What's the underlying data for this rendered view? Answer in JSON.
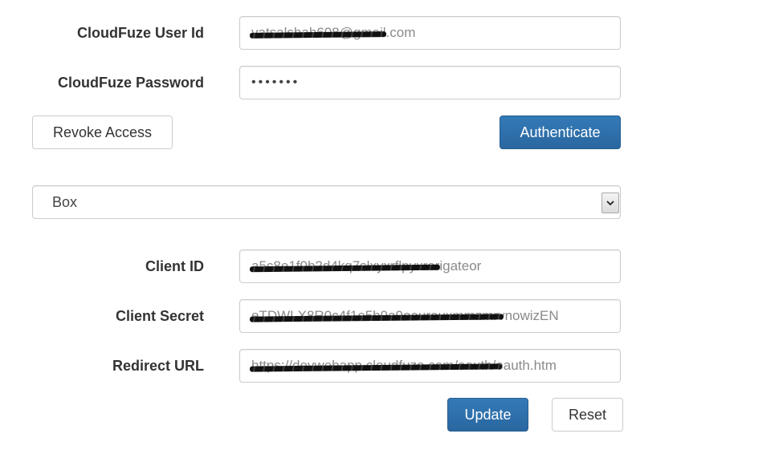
{
  "credentials": {
    "user_id_label": "CloudFuze User Id",
    "user_id_value": "vatsalshah608@gmail.com",
    "password_label": "CloudFuze Password",
    "password_value": "•••••••"
  },
  "actions": {
    "revoke_label": "Revoke Access",
    "authenticate_label": "Authenticate"
  },
  "provider": {
    "selected": "Box",
    "arrow_icon": "chevron-down-icon"
  },
  "app_config": {
    "client_id_label": "Client ID",
    "client_id_value": "a5c8e1f0b2d4kq7slxyxrflpyxrorigateor",
    "client_secret_label": "Client Secret",
    "client_secret_value": "eTDWLX8R0c4f1e5b9a9oaurouxmmzmrvnowizEN",
    "redirect_url_label": "Redirect URL",
    "redirect_url_value": "https://devwebapp.cloudfuze.com/oauth/oauth.htm"
  },
  "form_actions": {
    "update_label": "Update",
    "reset_label": "Reset"
  },
  "colors": {
    "primary": "#337ab7",
    "border": "#cccccc",
    "text": "#333333"
  }
}
